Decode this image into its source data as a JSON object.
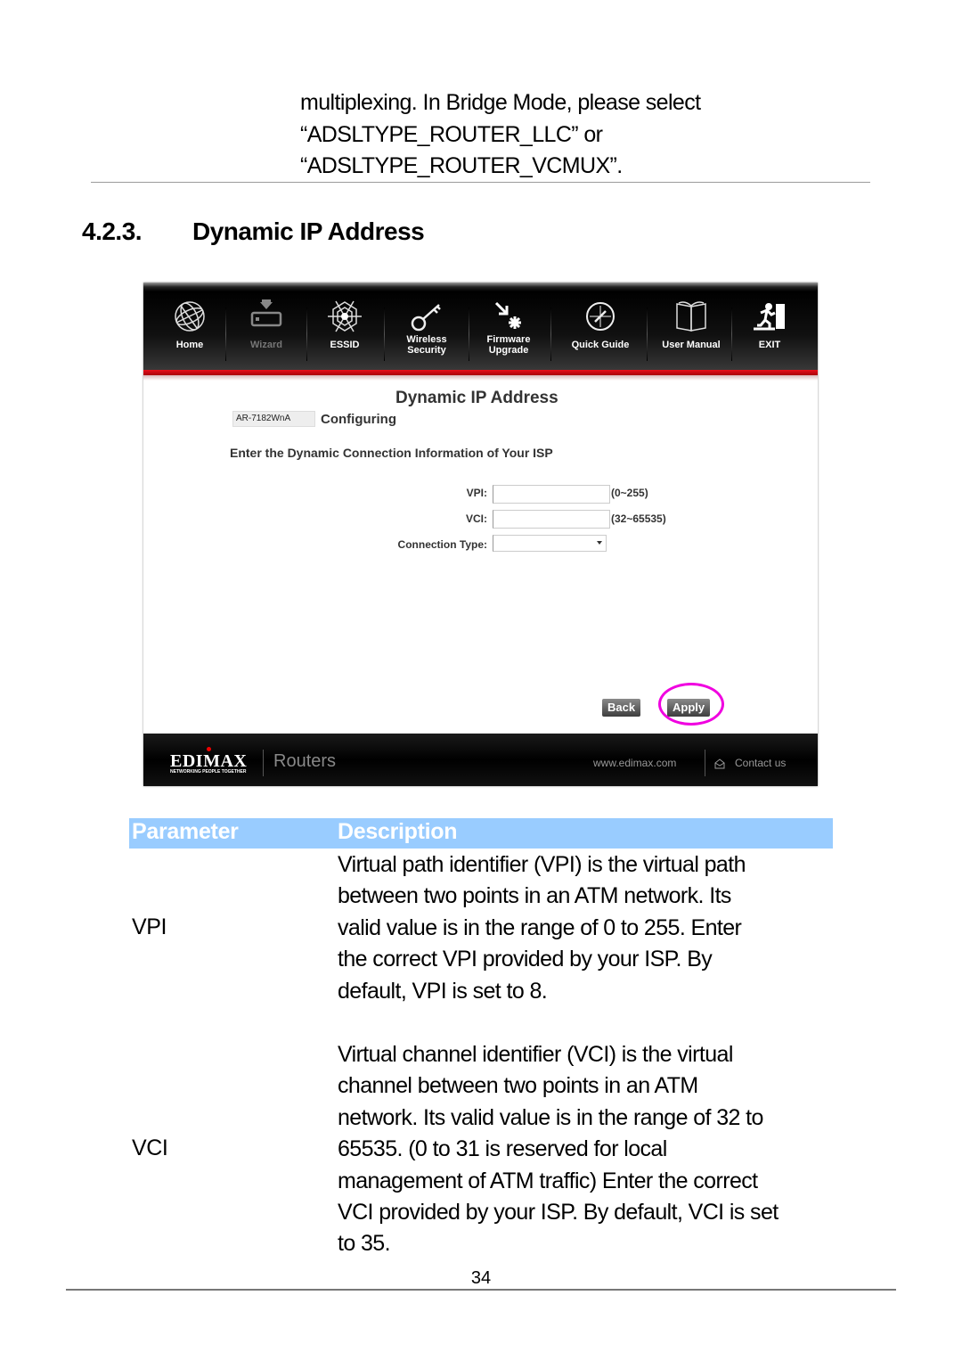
{
  "continuation_lines": [
    "multiplexing. In Bridge Mode, please select",
    "“ADSLTYPE_ROUTER_LLC” or",
    "“ADSLTYPE_ROUTER_VCMUX”."
  ],
  "section": {
    "number": "4.2.3.",
    "title": "Dynamic IP Address"
  },
  "router_ui": {
    "nav": [
      {
        "label": "Home",
        "icon": "globe-icon",
        "disabled": false
      },
      {
        "label": "Wizard",
        "icon": "wizard-device-icon",
        "disabled": true
      },
      {
        "label": "ESSID",
        "icon": "spiderweb-icon",
        "disabled": false
      },
      {
        "label": "Wireless Security",
        "icon": "key-icon",
        "disabled": false
      },
      {
        "label": "Firmware Upgrade",
        "icon": "firmware-arrow-icon",
        "disabled": false
      },
      {
        "label": "Quick Guide",
        "icon": "compass-icon",
        "disabled": false
      },
      {
        "label": "User Manual",
        "icon": "book-icon",
        "disabled": false
      },
      {
        "label": "EXIT",
        "icon": "exit-icon",
        "disabled": false
      }
    ],
    "panel_title": "Dynamic IP Address",
    "model": "AR-7182WnA",
    "status": "Configuring",
    "instruction": "Enter the Dynamic Connection Information of Your ISP",
    "fields": {
      "vpi": {
        "label": "VPI:",
        "value": "",
        "hint": "(0~255)"
      },
      "vci": {
        "label": "VCI:",
        "value": "",
        "hint": "(32~65535)"
      },
      "connection_type": {
        "label": "Connection Type:",
        "value": ""
      }
    },
    "buttons": {
      "back": "Back",
      "apply": "Apply"
    },
    "highlight_color": "#f000e0",
    "footer": {
      "logo": "EDIMAX",
      "tagline": "NETWORKING PEOPLE TOGETHER",
      "product": "Routers",
      "url": "www.edimax.com",
      "contact": "Contact us"
    }
  },
  "table": {
    "header_color": "#99ccff",
    "headers": {
      "parameter": "Parameter",
      "description": "Description"
    },
    "rows": [
      {
        "parameter": "VPI",
        "description_lines": [
          "Virtual path identifier (VPI) is the virtual path",
          "between two points in an ATM network. Its",
          "valid value is in the range of 0 to 255. Enter",
          "the correct VPI provided by your ISP. By",
          "default, VPI is set to 8."
        ]
      },
      {
        "parameter": "VCI",
        "description_lines": [
          "Virtual channel identifier (VCI) is the virtual",
          "channel between two points in an ATM",
          "network. Its valid value is in the range of 32 to",
          "65535. (0 to 31 is reserved for local",
          "management of ATM traffic) Enter the correct",
          "VCI provided by your ISP. By default, VCI is set",
          "to 35."
        ]
      }
    ]
  },
  "page_number": "34"
}
